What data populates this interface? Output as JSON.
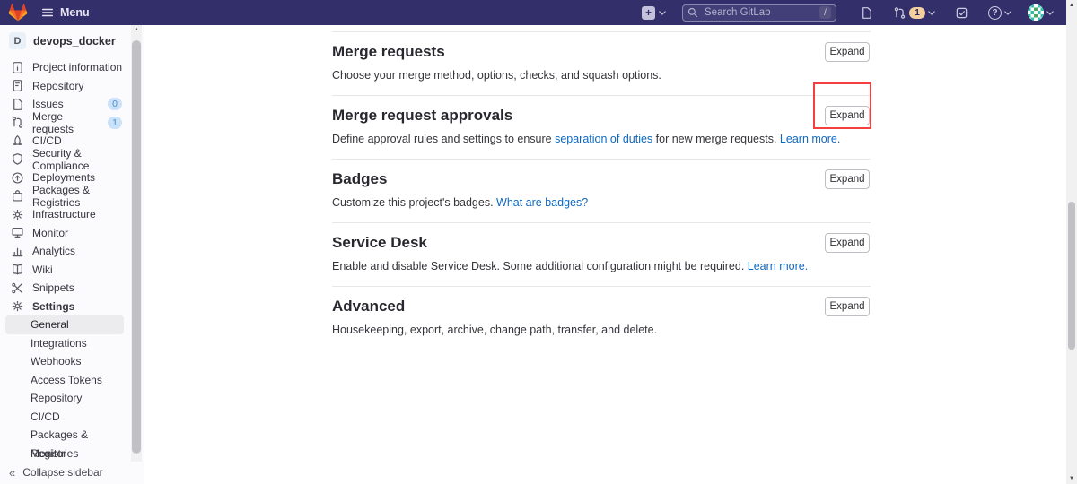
{
  "navbar": {
    "logo_icon": "gitlab-logo",
    "menu_label": "Menu",
    "plus_label": "+",
    "search": {
      "placeholder": "Search GitLab",
      "shortcut": "/"
    },
    "merge_requests_count": "1",
    "help_label": "?",
    "icons": [
      "hamburger-icon",
      "plus-icon",
      "chevron-down-icon",
      "search-icon",
      "issues-nav-icon",
      "merge-request-icon",
      "todo-icon",
      "help-icon",
      "avatar-identicon"
    ]
  },
  "sidebar": {
    "project": {
      "initial": "D",
      "name": "devops_docker"
    },
    "items": [
      {
        "icon": "project-information-icon",
        "label": "Project information"
      },
      {
        "icon": "repository-icon",
        "label": "Repository"
      },
      {
        "icon": "issues-icon",
        "label": "Issues",
        "badge": "0"
      },
      {
        "icon": "merge-requests-icon",
        "label": "Merge requests",
        "badge": "1"
      },
      {
        "icon": "ci-cd-icon",
        "label": "CI/CD"
      },
      {
        "icon": "security-compliance-icon",
        "label": "Security & Compliance"
      },
      {
        "icon": "deployments-icon",
        "label": "Deployments"
      },
      {
        "icon": "packages-registries-icon",
        "label": "Packages & Registries"
      },
      {
        "icon": "infrastructure-icon",
        "label": "Infrastructure"
      },
      {
        "icon": "monitor-icon",
        "label": "Monitor"
      },
      {
        "icon": "analytics-icon",
        "label": "Analytics"
      },
      {
        "icon": "wiki-icon",
        "label": "Wiki"
      },
      {
        "icon": "snippets-icon",
        "label": "Snippets"
      },
      {
        "icon": "settings-icon",
        "label": "Settings",
        "bold": true
      }
    ],
    "settings_subitems": [
      {
        "label": "General",
        "active": true
      },
      {
        "label": "Integrations"
      },
      {
        "label": "Webhooks"
      },
      {
        "label": "Access Tokens"
      },
      {
        "label": "Repository"
      },
      {
        "label": "CI/CD"
      },
      {
        "label": "Packages & Registries"
      },
      {
        "label": "Monitor"
      }
    ],
    "collapse_label": "Collapse sidebar",
    "collapse_icon": "collapse-chevron-icon"
  },
  "main": {
    "sections": [
      {
        "title": "Merge requests",
        "expand_label": "Expand",
        "description": [
          {
            "text": "Choose your merge method, options, checks, and squash options."
          }
        ]
      },
      {
        "title": "Merge request approvals",
        "expand_label": "Expand",
        "highlighted": true,
        "description": [
          {
            "text": "Define approval rules and settings to ensure "
          },
          {
            "text": "separation of duties",
            "link": true
          },
          {
            "text": " for new merge requests. "
          },
          {
            "text": "Learn more.",
            "link": true
          }
        ]
      },
      {
        "title": "Badges",
        "expand_label": "Expand",
        "description": [
          {
            "text": "Customize this project's badges. "
          },
          {
            "text": "What are badges?",
            "link": true
          }
        ]
      },
      {
        "title": "Service Desk",
        "expand_label": "Expand",
        "description": [
          {
            "text": "Enable and disable Service Desk. Some additional configuration might be required. "
          },
          {
            "text": "Learn more.",
            "link": true
          }
        ]
      },
      {
        "title": "Advanced",
        "expand_label": "Expand",
        "description": [
          {
            "text": "Housekeeping, export, archive, change path, transfer, and delete."
          }
        ]
      }
    ]
  },
  "colors": {
    "navbar_bg": "#332f6a",
    "link": "#1068bf",
    "annotation_red": "#f43f3f",
    "badge_pill_bg": "#cbe2f9",
    "mr_count_bg": "#f4d0a1",
    "active_item_bg": "#ececef",
    "logo_red": "#e24329",
    "logo_orange": "#fc6d26",
    "logo_yellow": "#fca326"
  }
}
